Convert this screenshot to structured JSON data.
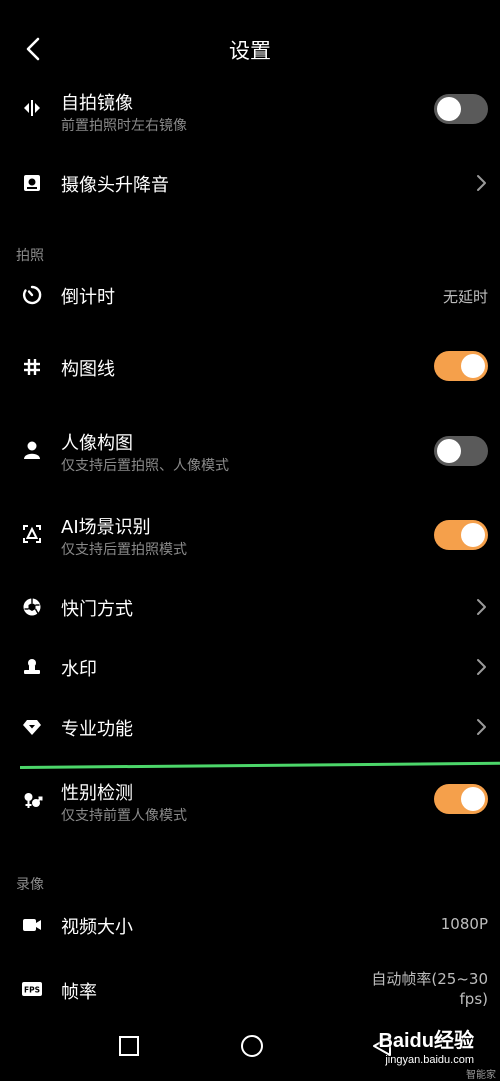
{
  "header": {
    "title": "设置"
  },
  "rows_top": [
    {
      "icon": "mirror-icon",
      "title": "自拍镜像",
      "subtitle": "前置拍照时左右镜像",
      "control": "toggle",
      "on": false
    },
    {
      "icon": "camera-rise-icon",
      "title": "摄像头升降音",
      "control": "chevron"
    }
  ],
  "sections": {
    "photo": "拍照",
    "video": "录像"
  },
  "rows_photo": [
    {
      "icon": "timer-icon",
      "title": "倒计时",
      "value": "无延时"
    },
    {
      "icon": "grid-icon",
      "title": "构图线",
      "control": "toggle",
      "on": true
    },
    {
      "icon": "portrait-icon",
      "title": "人像构图",
      "subtitle": "仅支持后置拍照、人像模式",
      "control": "toggle",
      "on": false
    },
    {
      "icon": "ai-scene-icon",
      "title": "AI场景识别",
      "subtitle": "仅支持后置拍照模式",
      "control": "toggle",
      "on": true
    },
    {
      "icon": "shutter-icon",
      "title": "快门方式",
      "control": "chevron"
    },
    {
      "icon": "watermark-icon",
      "title": "水印",
      "control": "chevron"
    },
    {
      "icon": "pro-icon",
      "title": "专业功能",
      "control": "chevron"
    },
    {
      "icon": "gender-icon",
      "title": "性别检测",
      "subtitle": "仅支持前置人像模式",
      "control": "toggle",
      "on": true
    }
  ],
  "rows_video": [
    {
      "icon": "video-icon",
      "title": "视频大小",
      "value": "1080P"
    },
    {
      "icon": "fps-icon",
      "title": "帧率",
      "value_line1": "自动帧率(25~30",
      "value_line2": "fps)"
    }
  ],
  "watermark": {
    "brand": "Baidu经验",
    "url": "jingyan.baidu.com",
    "sub": "智能家"
  },
  "colors": {
    "toggle_on": "#f5a04b",
    "toggle_off": "#5a5a5a",
    "divider_highlight": "#4cd66a"
  }
}
